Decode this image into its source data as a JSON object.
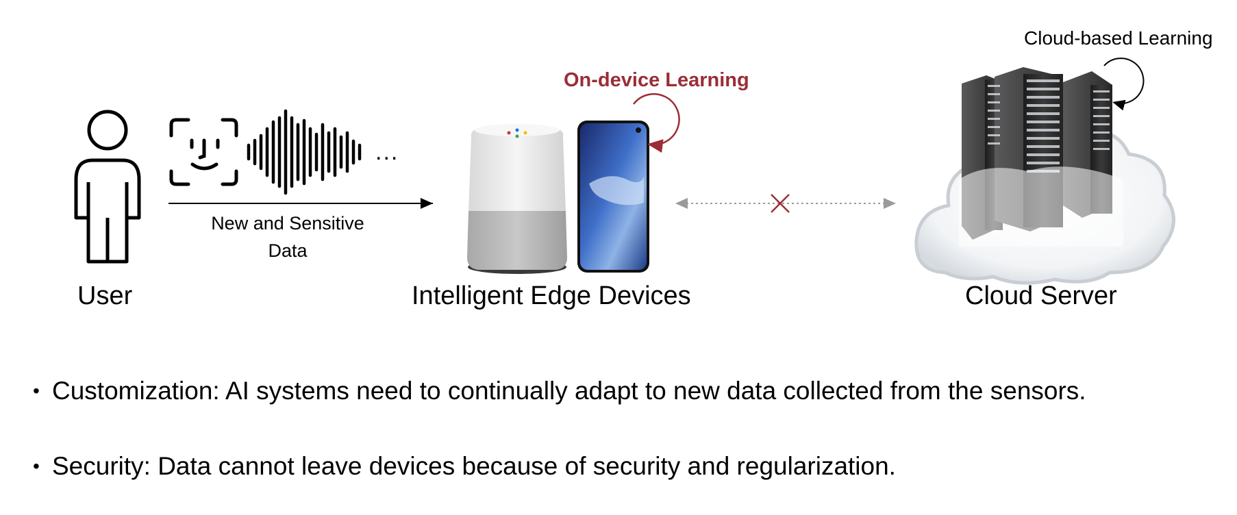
{
  "diagram": {
    "user_label": "User",
    "data_label_line1": "New and Sensitive",
    "data_label_line2": "Data",
    "ellipsis": "...",
    "edge_label": "Intelligent Edge Devices",
    "on_device_label": "On-device Learning",
    "cloud_label": "Cloud Server",
    "cloud_learning_label": "Cloud-based Learning"
  },
  "bullets": [
    {
      "marker": "•",
      "text": "Customization: AI systems need to continually adapt to new data collected from the sensors."
    },
    {
      "marker": "•",
      "text": "Security: Data cannot leave devices because of security and regularization."
    }
  ],
  "colors": {
    "accent": "#9b2d36",
    "speaker_top": "#ececec",
    "speaker_fabric": "#bdbdbd",
    "server_dark": "#2a2a2a",
    "cloud_stroke": "#c9ced4",
    "dotted_link": "#9a9a9a"
  }
}
